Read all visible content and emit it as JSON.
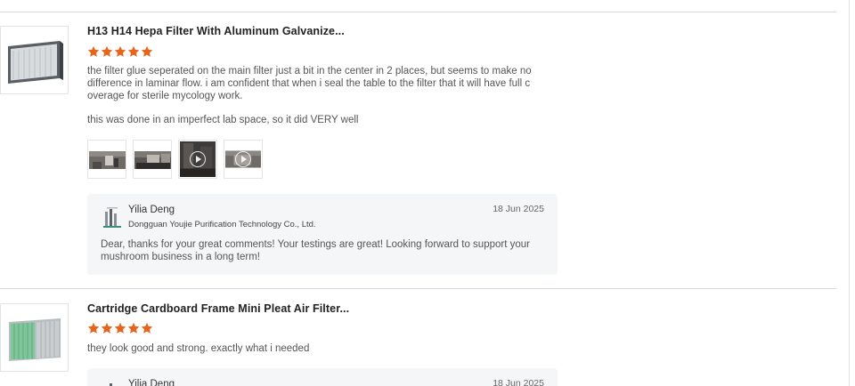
{
  "reviews": [
    {
      "product_title": "H13 H14 Hepa Filter With Aluminum Galvanize...",
      "rating": 5,
      "paragraphs": [
        "the filter glue seperated on the main filter just a bit in the center in 2 places, but seems to make no difference in laminar flow. i am confident that when i seal the table to the filter that it will have full coverage for sterile mycology work.",
        "this was done in an imperfect lab space, so it did VERY well"
      ],
      "media": [
        {
          "kind": "photo"
        },
        {
          "kind": "photo"
        },
        {
          "kind": "video"
        },
        {
          "kind": "video"
        }
      ],
      "reply": {
        "name": "Yilia Deng",
        "company": "Dongguan Youjie Purification Technology Co., Ltd.",
        "date": "18 Jun 2025",
        "text": "Dear, thanks for your great comments! Your testings are great! Looking forward to support your mushroom business in a long term!"
      }
    },
    {
      "product_title": "Cartridge Cardboard Frame Mini Pleat Air Filter...",
      "rating": 5,
      "paragraphs": [
        "they look good and strong. exactly what i needed"
      ],
      "reply": {
        "name": "Yilia Deng",
        "date": "18 Jun 2025"
      }
    }
  ],
  "colors": {
    "star": "#e8641b",
    "reply_bg": "#f5f6f7",
    "divider": "#dcdcdc"
  },
  "icons": {
    "star": "star-icon",
    "play": "play-icon",
    "logo": "company-logo"
  }
}
